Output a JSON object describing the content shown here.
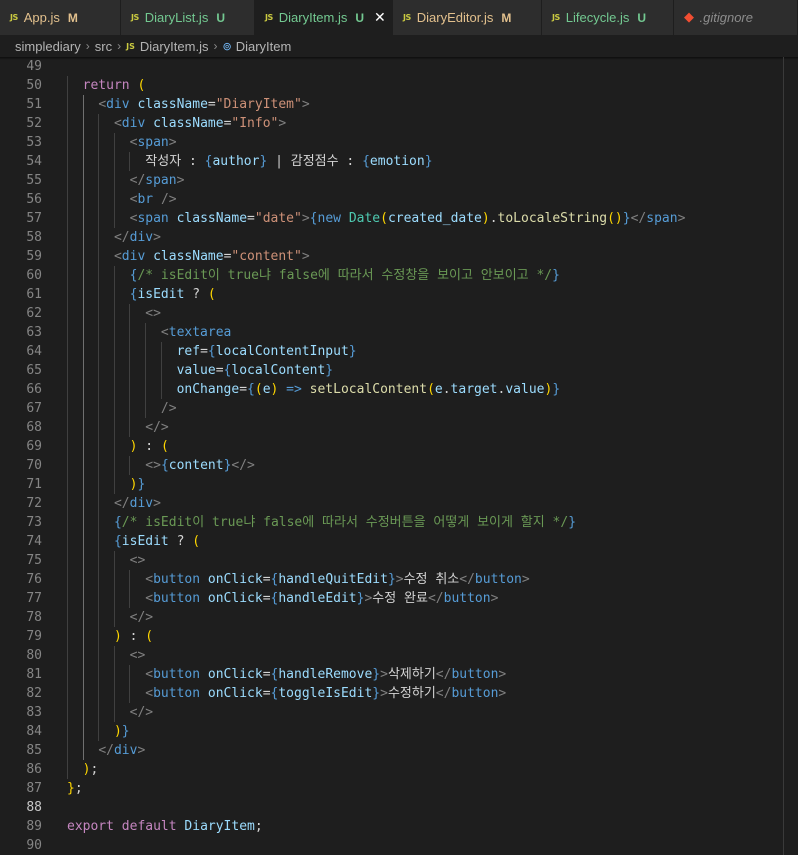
{
  "tabs": [
    {
      "label": "App.js",
      "status": "M",
      "kind": "modified",
      "icon": "javascript-file-icon"
    },
    {
      "label": "DiaryList.js",
      "status": "U",
      "kind": "untracked",
      "icon": "javascript-file-icon"
    },
    {
      "label": "DiaryItem.js",
      "status": "U",
      "kind": "untracked",
      "icon": "javascript-file-icon",
      "active": true
    },
    {
      "label": "DiaryEditor.js",
      "status": "M",
      "kind": "modified",
      "icon": "javascript-file-icon"
    },
    {
      "label": "Lifecycle.js",
      "status": "U",
      "kind": "untracked",
      "icon": "javascript-file-icon"
    },
    {
      "label": ".gitignore",
      "status": "",
      "kind": "gitignore",
      "icon": "git-icon"
    }
  ],
  "file_icon_text": "JS",
  "close_glyph": "✕",
  "breadcrumb": {
    "parts": [
      "simplediary",
      "src",
      "DiaryItem.js",
      "DiaryItem"
    ],
    "separator": "›"
  },
  "editor": {
    "current_line": 88,
    "lines": [
      {
        "n": 49,
        "indent": 0,
        "t": []
      },
      {
        "n": 50,
        "indent": 2,
        "t": [
          [
            "kw",
            "return"
          ],
          [
            "tx",
            " "
          ],
          [
            "b1",
            "("
          ]
        ]
      },
      {
        "n": 51,
        "indent": 4,
        "t": [
          [
            "pn",
            "<"
          ],
          [
            "tg",
            "div"
          ],
          [
            "tx",
            " "
          ],
          [
            "at",
            "className"
          ],
          [
            "tx",
            "="
          ],
          [
            "st",
            "\"DiaryItem\""
          ],
          [
            "pn",
            ">"
          ]
        ]
      },
      {
        "n": 52,
        "indent": 6,
        "t": [
          [
            "pn",
            "<"
          ],
          [
            "tg",
            "div"
          ],
          [
            "tx",
            " "
          ],
          [
            "at",
            "className"
          ],
          [
            "tx",
            "="
          ],
          [
            "st",
            "\"Info\""
          ],
          [
            "pn",
            ">"
          ]
        ]
      },
      {
        "n": 53,
        "indent": 8,
        "t": [
          [
            "pn",
            "<"
          ],
          [
            "tg",
            "span"
          ],
          [
            "pn",
            ">"
          ]
        ]
      },
      {
        "n": 54,
        "indent": 10,
        "t": [
          [
            "tx",
            "작성자 : "
          ],
          [
            "kb",
            "{"
          ],
          [
            "vr",
            "author"
          ],
          [
            "kb",
            "}"
          ],
          [
            "tx",
            " | 감정점수 : "
          ],
          [
            "kb",
            "{"
          ],
          [
            "vr",
            "emotion"
          ],
          [
            "kb",
            "}"
          ]
        ]
      },
      {
        "n": 55,
        "indent": 8,
        "t": [
          [
            "pn",
            "</"
          ],
          [
            "tg",
            "span"
          ],
          [
            "pn",
            ">"
          ]
        ]
      },
      {
        "n": 56,
        "indent": 8,
        "t": [
          [
            "pn",
            "<"
          ],
          [
            "tg",
            "br"
          ],
          [
            "tx",
            " "
          ],
          [
            "pn",
            "/>"
          ]
        ]
      },
      {
        "n": 57,
        "indent": 8,
        "t": [
          [
            "pn",
            "<"
          ],
          [
            "tg",
            "span"
          ],
          [
            "tx",
            " "
          ],
          [
            "at",
            "className"
          ],
          [
            "tx",
            "="
          ],
          [
            "st",
            "\"date\""
          ],
          [
            "pn",
            ">"
          ],
          [
            "kb",
            "{"
          ],
          [
            "kb",
            "new"
          ],
          [
            "tx",
            " "
          ],
          [
            "cls",
            "Date"
          ],
          [
            "b1",
            "("
          ],
          [
            "vr",
            "created_date"
          ],
          [
            "b1",
            ")"
          ],
          [
            "tx",
            "."
          ],
          [
            "fn",
            "toLocaleString"
          ],
          [
            "b1",
            "()"
          ],
          [
            "kb",
            "}"
          ],
          [
            "pn",
            "</"
          ],
          [
            "tg",
            "span"
          ],
          [
            "pn",
            ">"
          ]
        ]
      },
      {
        "n": 58,
        "indent": 6,
        "t": [
          [
            "pn",
            "</"
          ],
          [
            "tg",
            "div"
          ],
          [
            "pn",
            ">"
          ]
        ]
      },
      {
        "n": 59,
        "indent": 6,
        "t": [
          [
            "pn",
            "<"
          ],
          [
            "tg",
            "div"
          ],
          [
            "tx",
            " "
          ],
          [
            "at",
            "className"
          ],
          [
            "tx",
            "="
          ],
          [
            "st",
            "\"content\""
          ],
          [
            "pn",
            ">"
          ]
        ]
      },
      {
        "n": 60,
        "indent": 8,
        "t": [
          [
            "kb",
            "{"
          ],
          [
            "cm",
            "/* isEdit이 true냐 false에 따라서 수정창을 보이고 안보이고 */"
          ],
          [
            "kb",
            "}"
          ]
        ]
      },
      {
        "n": 61,
        "indent": 8,
        "t": [
          [
            "kb",
            "{"
          ],
          [
            "vr",
            "isEdit"
          ],
          [
            "tx",
            " ? "
          ],
          [
            "b1",
            "("
          ]
        ]
      },
      {
        "n": 62,
        "indent": 10,
        "t": [
          [
            "pn",
            "<>"
          ]
        ]
      },
      {
        "n": 63,
        "indent": 12,
        "t": [
          [
            "pn",
            "<"
          ],
          [
            "tg",
            "textarea"
          ]
        ]
      },
      {
        "n": 64,
        "indent": 14,
        "t": [
          [
            "at",
            "ref"
          ],
          [
            "tx",
            "="
          ],
          [
            "kb",
            "{"
          ],
          [
            "vr",
            "localContentInput"
          ],
          [
            "kb",
            "}"
          ]
        ]
      },
      {
        "n": 65,
        "indent": 14,
        "t": [
          [
            "at",
            "value"
          ],
          [
            "tx",
            "="
          ],
          [
            "kb",
            "{"
          ],
          [
            "vr",
            "localContent"
          ],
          [
            "kb",
            "}"
          ]
        ]
      },
      {
        "n": 66,
        "indent": 14,
        "t": [
          [
            "at",
            "onChange"
          ],
          [
            "tx",
            "="
          ],
          [
            "kb",
            "{"
          ],
          [
            "b1",
            "("
          ],
          [
            "vr",
            "e"
          ],
          [
            "b1",
            ")"
          ],
          [
            "tx",
            " "
          ],
          [
            "kb",
            "=>"
          ],
          [
            "tx",
            " "
          ],
          [
            "fn",
            "setLocalContent"
          ],
          [
            "b1",
            "("
          ],
          [
            "vr",
            "e"
          ],
          [
            "tx",
            "."
          ],
          [
            "vr",
            "target"
          ],
          [
            "tx",
            "."
          ],
          [
            "vr",
            "value"
          ],
          [
            "b1",
            ")"
          ],
          [
            "kb",
            "}"
          ]
        ]
      },
      {
        "n": 67,
        "indent": 12,
        "t": [
          [
            "pn",
            "/>"
          ]
        ]
      },
      {
        "n": 68,
        "indent": 10,
        "t": [
          [
            "pn",
            "</>"
          ]
        ]
      },
      {
        "n": 69,
        "indent": 8,
        "t": [
          [
            "b1",
            ")"
          ],
          [
            "tx",
            " : "
          ],
          [
            "b1",
            "("
          ]
        ]
      },
      {
        "n": 70,
        "indent": 10,
        "t": [
          [
            "pn",
            "<>"
          ],
          [
            "kb",
            "{"
          ],
          [
            "vr",
            "content"
          ],
          [
            "kb",
            "}"
          ],
          [
            "pn",
            "</>"
          ]
        ]
      },
      {
        "n": 71,
        "indent": 8,
        "t": [
          [
            "b1",
            ")"
          ],
          [
            "kb",
            "}"
          ]
        ]
      },
      {
        "n": 72,
        "indent": 6,
        "t": [
          [
            "pn",
            "</"
          ],
          [
            "tg",
            "div"
          ],
          [
            "pn",
            ">"
          ]
        ]
      },
      {
        "n": 73,
        "indent": 6,
        "t": [
          [
            "kb",
            "{"
          ],
          [
            "cm",
            "/* isEdit이 true냐 false에 따라서 수정버튼을 어떻게 보이게 할지 */"
          ],
          [
            "kb",
            "}"
          ]
        ]
      },
      {
        "n": 74,
        "indent": 6,
        "t": [
          [
            "kb",
            "{"
          ],
          [
            "vr",
            "isEdit"
          ],
          [
            "tx",
            " ? "
          ],
          [
            "b1",
            "("
          ]
        ]
      },
      {
        "n": 75,
        "indent": 8,
        "t": [
          [
            "pn",
            "<>"
          ]
        ]
      },
      {
        "n": 76,
        "indent": 10,
        "t": [
          [
            "pn",
            "<"
          ],
          [
            "tg",
            "button"
          ],
          [
            "tx",
            " "
          ],
          [
            "at",
            "onClick"
          ],
          [
            "tx",
            "="
          ],
          [
            "kb",
            "{"
          ],
          [
            "vr",
            "handleQuitEdit"
          ],
          [
            "kb",
            "}"
          ],
          [
            "pn",
            ">"
          ],
          [
            "tx",
            "수정 취소"
          ],
          [
            "pn",
            "</"
          ],
          [
            "tg",
            "button"
          ],
          [
            "pn",
            ">"
          ]
        ]
      },
      {
        "n": 77,
        "indent": 10,
        "t": [
          [
            "pn",
            "<"
          ],
          [
            "tg",
            "button"
          ],
          [
            "tx",
            " "
          ],
          [
            "at",
            "onClick"
          ],
          [
            "tx",
            "="
          ],
          [
            "kb",
            "{"
          ],
          [
            "vr",
            "handleEdit"
          ],
          [
            "kb",
            "}"
          ],
          [
            "pn",
            ">"
          ],
          [
            "tx",
            "수정 완료"
          ],
          [
            "pn",
            "</"
          ],
          [
            "tg",
            "button"
          ],
          [
            "pn",
            ">"
          ]
        ]
      },
      {
        "n": 78,
        "indent": 8,
        "t": [
          [
            "pn",
            "</>"
          ]
        ]
      },
      {
        "n": 79,
        "indent": 6,
        "t": [
          [
            "b1",
            ")"
          ],
          [
            "tx",
            " : "
          ],
          [
            "b1",
            "("
          ]
        ]
      },
      {
        "n": 80,
        "indent": 8,
        "t": [
          [
            "pn",
            "<>"
          ]
        ]
      },
      {
        "n": 81,
        "indent": 10,
        "t": [
          [
            "pn",
            "<"
          ],
          [
            "tg",
            "button"
          ],
          [
            "tx",
            " "
          ],
          [
            "at",
            "onClick"
          ],
          [
            "tx",
            "="
          ],
          [
            "kb",
            "{"
          ],
          [
            "vr",
            "handleRemove"
          ],
          [
            "kb",
            "}"
          ],
          [
            "pn",
            ">"
          ],
          [
            "tx",
            "삭제하기"
          ],
          [
            "pn",
            "</"
          ],
          [
            "tg",
            "button"
          ],
          [
            "pn",
            ">"
          ]
        ]
      },
      {
        "n": 82,
        "indent": 10,
        "t": [
          [
            "pn",
            "<"
          ],
          [
            "tg",
            "button"
          ],
          [
            "tx",
            " "
          ],
          [
            "at",
            "onClick"
          ],
          [
            "tx",
            "="
          ],
          [
            "kb",
            "{"
          ],
          [
            "vr",
            "toggleIsEdit"
          ],
          [
            "kb",
            "}"
          ],
          [
            "pn",
            ">"
          ],
          [
            "tx",
            "수정하기"
          ],
          [
            "pn",
            "</"
          ],
          [
            "tg",
            "button"
          ],
          [
            "pn",
            ">"
          ]
        ]
      },
      {
        "n": 83,
        "indent": 8,
        "t": [
          [
            "pn",
            "</>"
          ]
        ]
      },
      {
        "n": 84,
        "indent": 6,
        "t": [
          [
            "b1",
            ")"
          ],
          [
            "kb",
            "}"
          ]
        ]
      },
      {
        "n": 85,
        "indent": 4,
        "t": [
          [
            "pn",
            "</"
          ],
          [
            "tg",
            "div"
          ],
          [
            "pn",
            ">"
          ]
        ]
      },
      {
        "n": 86,
        "indent": 2,
        "t": [
          [
            "b1",
            ")"
          ],
          [
            "tx",
            ";"
          ]
        ]
      },
      {
        "n": 87,
        "indent": 0,
        "t": [
          [
            "b1",
            "}"
          ],
          [
            "tx",
            ";"
          ]
        ]
      },
      {
        "n": 88,
        "indent": 0,
        "t": []
      },
      {
        "n": 89,
        "indent": 0,
        "t": [
          [
            "kw",
            "export"
          ],
          [
            "tx",
            " "
          ],
          [
            "kw",
            "default"
          ],
          [
            "tx",
            " "
          ],
          [
            "vr",
            "DiaryItem"
          ],
          [
            "tx",
            ";"
          ]
        ]
      },
      {
        "n": 90,
        "indent": 0,
        "t": []
      }
    ]
  }
}
